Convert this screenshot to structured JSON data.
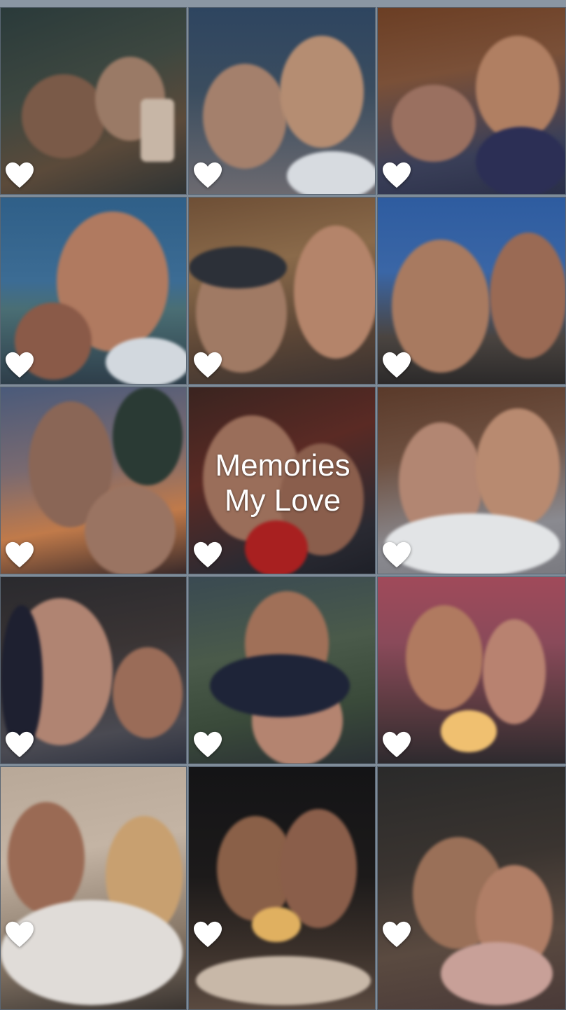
{
  "title": {
    "line1": "Memories",
    "line2": "My Love"
  },
  "tiles": [
    {
      "icon": "heart-icon",
      "scene": "selfie-mirror"
    },
    {
      "icon": "heart-icon",
      "scene": "smiling-couple"
    },
    {
      "icon": "heart-icon",
      "scene": "sunglasses-couple"
    },
    {
      "icon": "heart-icon",
      "scene": "cap-sunglasses-seaside"
    },
    {
      "icon": "heart-icon",
      "scene": "cap-selfie-lights"
    },
    {
      "icon": "heart-icon",
      "scene": "blue-sky-selfie"
    },
    {
      "icon": "heart-icon",
      "scene": "sunset-palms"
    },
    {
      "icon": "heart-icon",
      "scene": "red-jacket-hug"
    },
    {
      "icon": "heart-icon",
      "scene": "white-shirts"
    },
    {
      "icon": "heart-icon",
      "scene": "hand-on-cheek"
    },
    {
      "icon": "heart-icon",
      "scene": "outdoor-hug"
    },
    {
      "icon": "heart-icon",
      "scene": "birthday-cake-pink"
    },
    {
      "icon": "heart-icon",
      "scene": "feeding-dessert"
    },
    {
      "icon": "heart-icon",
      "scene": "candle-cake-night"
    },
    {
      "icon": "heart-icon",
      "scene": "restaurant-kiss"
    }
  ],
  "colors": {
    "heart": "#ffffff",
    "grid_border": "#5a6673",
    "title": "#ffffff"
  }
}
